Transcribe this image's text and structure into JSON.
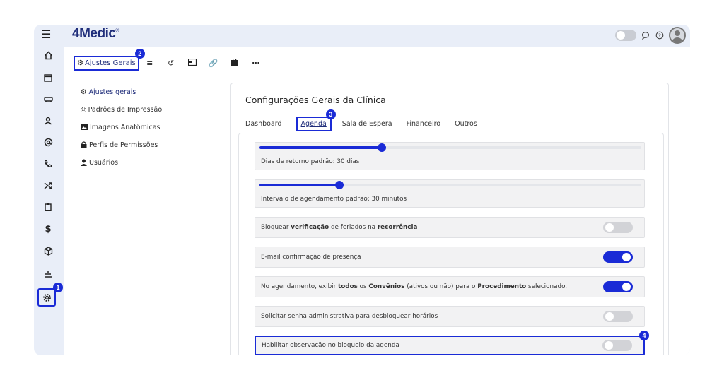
{
  "app": {
    "logo": "4Medic",
    "logo_reg": "®"
  },
  "topbar": {
    "help_label": "?"
  },
  "toolbar": {
    "active_label": "Ajustes Gerais"
  },
  "left_menu": [
    {
      "icon": "gears-icon",
      "label": "Ajustes gerais"
    },
    {
      "icon": "printer-icon",
      "label": "Padrões de Impressão"
    },
    {
      "icon": "image-icon",
      "label": "Imagens Anatômicas"
    },
    {
      "icon": "lock-icon",
      "label": "Perfis de Permissões"
    },
    {
      "icon": "user-icon",
      "label": "Usuários"
    }
  ],
  "panel": {
    "title": "Configurações Gerais da Clínica",
    "tabs": [
      "Dashboard",
      "Agenda",
      "Sala de Espera",
      "Financeiro",
      "Outros"
    ],
    "active_tab": "Agenda"
  },
  "settings": {
    "slider1": {
      "label": "Dias de retorno padrão: 30 dias",
      "value_fraction": 0.32
    },
    "slider2": {
      "label": "Intervalo de agendamento padrão: 30 minutos",
      "value_fraction": 0.21
    },
    "toggles": [
      {
        "parts": [
          "Bloquear ",
          "verificação",
          " de feriados na ",
          "recorrência",
          ""
        ],
        "on": false
      },
      {
        "parts": [
          "E-mail confirmação de presença",
          "",
          "",
          "",
          ""
        ],
        "on": true
      },
      {
        "parts": [
          "No agendamento, exibir ",
          "todos",
          " os ",
          "Convênios",
          " (ativos ou não) para o "
        ],
        "extra_bold": "Procedimento",
        "extra_tail": " selecionado.",
        "on": true
      },
      {
        "parts": [
          "Solicitar senha administrativa para desbloquear horários",
          "",
          "",
          "",
          ""
        ],
        "on": false
      },
      {
        "parts": [
          "Habilitar observação no bloqueio da agenda",
          "",
          "",
          "",
          ""
        ],
        "on": false
      }
    ]
  },
  "badges": [
    "1",
    "2",
    "3",
    "4"
  ],
  "colors": {
    "accent": "#1a2bd6",
    "brand": "#1f2d7a"
  }
}
